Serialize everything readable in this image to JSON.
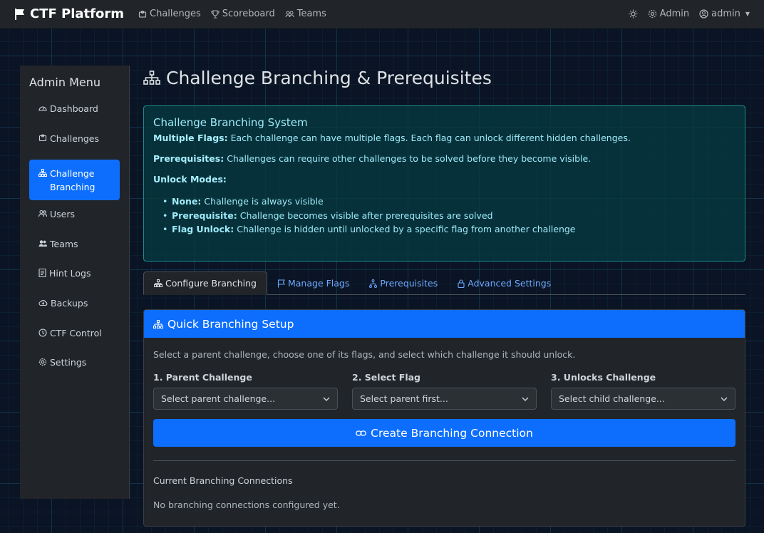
{
  "navbar": {
    "brand": "CTF Platform",
    "links": [
      "Challenges",
      "Scoreboard",
      "Teams"
    ],
    "admin_label": "Admin",
    "user_label": "admin"
  },
  "sidebar": {
    "title": "Admin Menu",
    "items": [
      {
        "label": "Dashboard",
        "icon": "speedometer-icon"
      },
      {
        "label": "Challenges",
        "icon": "puzzle-icon"
      },
      {
        "label": "Challenge Branching",
        "icon": "diagram-icon",
        "active": true
      },
      {
        "label": "Users",
        "icon": "users-icon"
      },
      {
        "label": "Teams",
        "icon": "team-icon"
      },
      {
        "label": "Hint Logs",
        "icon": "log-icon"
      },
      {
        "label": "Backups",
        "icon": "cloud-icon"
      },
      {
        "label": "CTF Control",
        "icon": "clock-icon"
      },
      {
        "label": "Settings",
        "icon": "gear-icon"
      }
    ]
  },
  "page": {
    "title": "Challenge Branching & Prerequisites"
  },
  "info": {
    "title": "Challenge Branching System",
    "multiple_flags_label": "Multiple Flags:",
    "multiple_flags_text": "Each challenge can have multiple flags. Each flag can unlock different hidden challenges.",
    "prereq_label": "Prerequisites:",
    "prereq_text": "Challenges can require other challenges to be solved before they become visible.",
    "unlock_modes_label": "Unlock Modes:",
    "modes": [
      {
        "label": "None:",
        "text": "Challenge is always visible"
      },
      {
        "label": "Prerequisite:",
        "text": "Challenge becomes visible after prerequisites are solved"
      },
      {
        "label": "Flag Unlock:",
        "text": "Challenge is hidden until unlocked by a specific flag from another challenge"
      }
    ]
  },
  "tabs": [
    "Configure Branching",
    "Manage Flags",
    "Prerequisites",
    "Advanced Settings"
  ],
  "setup": {
    "title": "Quick Branching Setup",
    "description": "Select a parent challenge, choose one of its flags, and select which challenge it should unlock.",
    "fields": [
      {
        "label": "1. Parent Challenge",
        "placeholder": "Select parent challenge..."
      },
      {
        "label": "2. Select Flag",
        "placeholder": "Select parent first..."
      },
      {
        "label": "3. Unlocks Challenge",
        "placeholder": "Select child challenge..."
      }
    ],
    "button_label": "Create Branching Connection",
    "current_title": "Current Branching Connections",
    "empty_text": "No branching connections configured yet."
  },
  "colors": {
    "primary": "#0d6efd",
    "info_text": "#9eeaf9",
    "navbar_bg": "#212529"
  }
}
